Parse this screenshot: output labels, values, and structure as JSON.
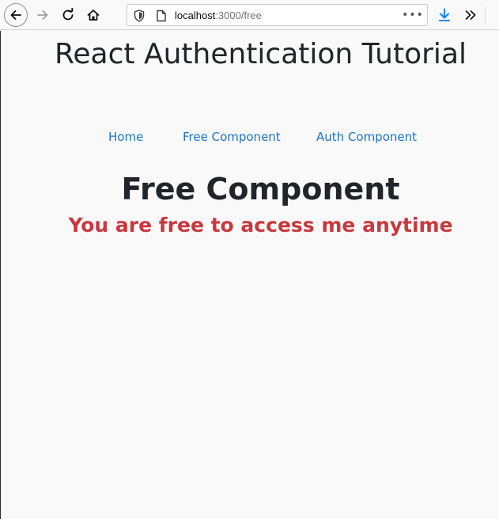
{
  "browser": {
    "url_host": "localhost",
    "url_path": ":3000/free",
    "more_label": "•••"
  },
  "page": {
    "title": "React Authentication Tutorial",
    "nav": {
      "home": "Home",
      "free": "Free Component",
      "auth": "Auth Component"
    },
    "heading": "Free Component",
    "message": "You are free to access me anytime"
  },
  "colors": {
    "link": "#1a73c7",
    "message": "#c8383d",
    "text": "#212529",
    "download_accent": "#0a84ff"
  }
}
